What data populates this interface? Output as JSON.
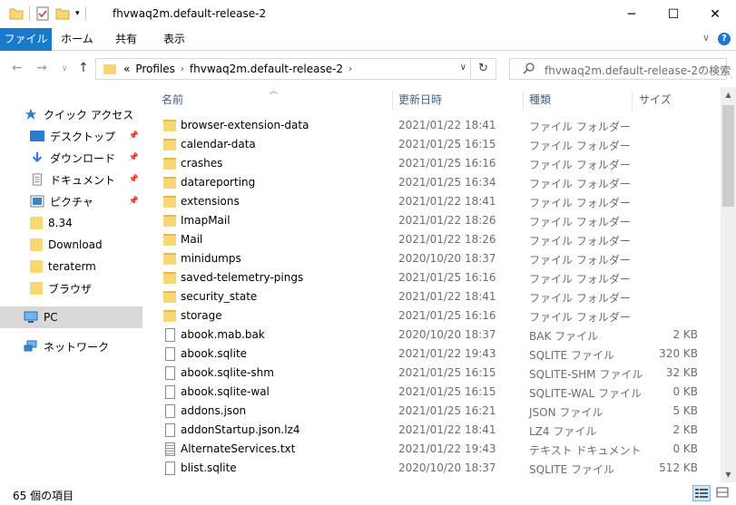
{
  "window": {
    "title": "fhvwaq2m.default-release-2",
    "minimize": "─",
    "maximize": "☐",
    "close": "✕"
  },
  "ribbon": {
    "tabs": [
      "ファイル",
      "ホーム",
      "共有",
      "表示"
    ],
    "expand": "∨",
    "help": "?"
  },
  "nav": {
    "back": "←",
    "forward": "→",
    "recent": "∨",
    "up": "↑",
    "breadcrumb_overflow": "«",
    "breadcrumb": [
      "Profiles",
      "fhvwaq2m.default-release-2"
    ],
    "separator": "›",
    "dropdown": "∨",
    "refresh": "↻"
  },
  "search": {
    "placeholder": "fhvwaq2m.default-release-2の検索",
    "icon": "search-icon"
  },
  "columns": {
    "name": "名前",
    "date": "更新日時",
    "type": "種類",
    "size": "サイズ"
  },
  "sidebar": {
    "quick_access": "クイック アクセス",
    "items": [
      {
        "label": "デスクトップ",
        "icon": "desktop-icon",
        "pinned": true
      },
      {
        "label": "ダウンロード",
        "icon": "download-icon",
        "pinned": true
      },
      {
        "label": "ドキュメント",
        "icon": "document-icon",
        "pinned": true
      },
      {
        "label": "ピクチャ",
        "icon": "picture-icon",
        "pinned": true
      },
      {
        "label": "8.34",
        "icon": "folder-icon",
        "pinned": false
      },
      {
        "label": "Download",
        "icon": "folder-icon",
        "pinned": false
      },
      {
        "label": "teraterm",
        "icon": "folder-icon",
        "pinned": false
      },
      {
        "label": "ブラウザ",
        "icon": "folder-icon",
        "pinned": false
      }
    ],
    "pc": "PC",
    "network": "ネットワーク",
    "pin_glyph": "📌"
  },
  "files": [
    {
      "name": "browser-extension-data",
      "date": "2021/01/22 18:41",
      "type": "ファイル フォルダー",
      "size": "",
      "kind": "folder"
    },
    {
      "name": "calendar-data",
      "date": "2021/01/25 16:15",
      "type": "ファイル フォルダー",
      "size": "",
      "kind": "folder"
    },
    {
      "name": "crashes",
      "date": "2021/01/25 16:16",
      "type": "ファイル フォルダー",
      "size": "",
      "kind": "folder"
    },
    {
      "name": "datareporting",
      "date": "2021/01/25 16:34",
      "type": "ファイル フォルダー",
      "size": "",
      "kind": "folder"
    },
    {
      "name": "extensions",
      "date": "2021/01/22 18:41",
      "type": "ファイル フォルダー",
      "size": "",
      "kind": "folder"
    },
    {
      "name": "ImapMail",
      "date": "2021/01/22 18:26",
      "type": "ファイル フォルダー",
      "size": "",
      "kind": "folder"
    },
    {
      "name": "Mail",
      "date": "2021/01/22 18:26",
      "type": "ファイル フォルダー",
      "size": "",
      "kind": "folder"
    },
    {
      "name": "minidumps",
      "date": "2020/10/20 18:37",
      "type": "ファイル フォルダー",
      "size": "",
      "kind": "folder"
    },
    {
      "name": "saved-telemetry-pings",
      "date": "2021/01/25 16:16",
      "type": "ファイル フォルダー",
      "size": "",
      "kind": "folder"
    },
    {
      "name": "security_state",
      "date": "2021/01/22 18:41",
      "type": "ファイル フォルダー",
      "size": "",
      "kind": "folder"
    },
    {
      "name": "storage",
      "date": "2021/01/25 16:16",
      "type": "ファイル フォルダー",
      "size": "",
      "kind": "folder"
    },
    {
      "name": "abook.mab.bak",
      "date": "2020/10/20 18:37",
      "type": "BAK ファイル",
      "size": "2 KB",
      "kind": "file"
    },
    {
      "name": "abook.sqlite",
      "date": "2021/01/22 19:43",
      "type": "SQLITE ファイル",
      "size": "320 KB",
      "kind": "file"
    },
    {
      "name": "abook.sqlite-shm",
      "date": "2021/01/25 16:15",
      "type": "SQLITE-SHM ファイル",
      "size": "32 KB",
      "kind": "file"
    },
    {
      "name": "abook.sqlite-wal",
      "date": "2021/01/25 16:15",
      "type": "SQLITE-WAL ファイル",
      "size": "0 KB",
      "kind": "file"
    },
    {
      "name": "addons.json",
      "date": "2021/01/25 16:21",
      "type": "JSON ファイル",
      "size": "5 KB",
      "kind": "file"
    },
    {
      "name": "addonStartup.json.lz4",
      "date": "2021/01/22 18:41",
      "type": "LZ4 ファイル",
      "size": "2 KB",
      "kind": "file"
    },
    {
      "name": "AlternateServices.txt",
      "date": "2021/01/22 19:43",
      "type": "テキスト ドキュメント",
      "size": "0 KB",
      "kind": "text"
    },
    {
      "name": "blist.sqlite",
      "date": "2020/10/20 18:37",
      "type": "SQLITE ファイル",
      "size": "512 KB",
      "kind": "file"
    }
  ],
  "status": {
    "count": "65 個の項目"
  }
}
